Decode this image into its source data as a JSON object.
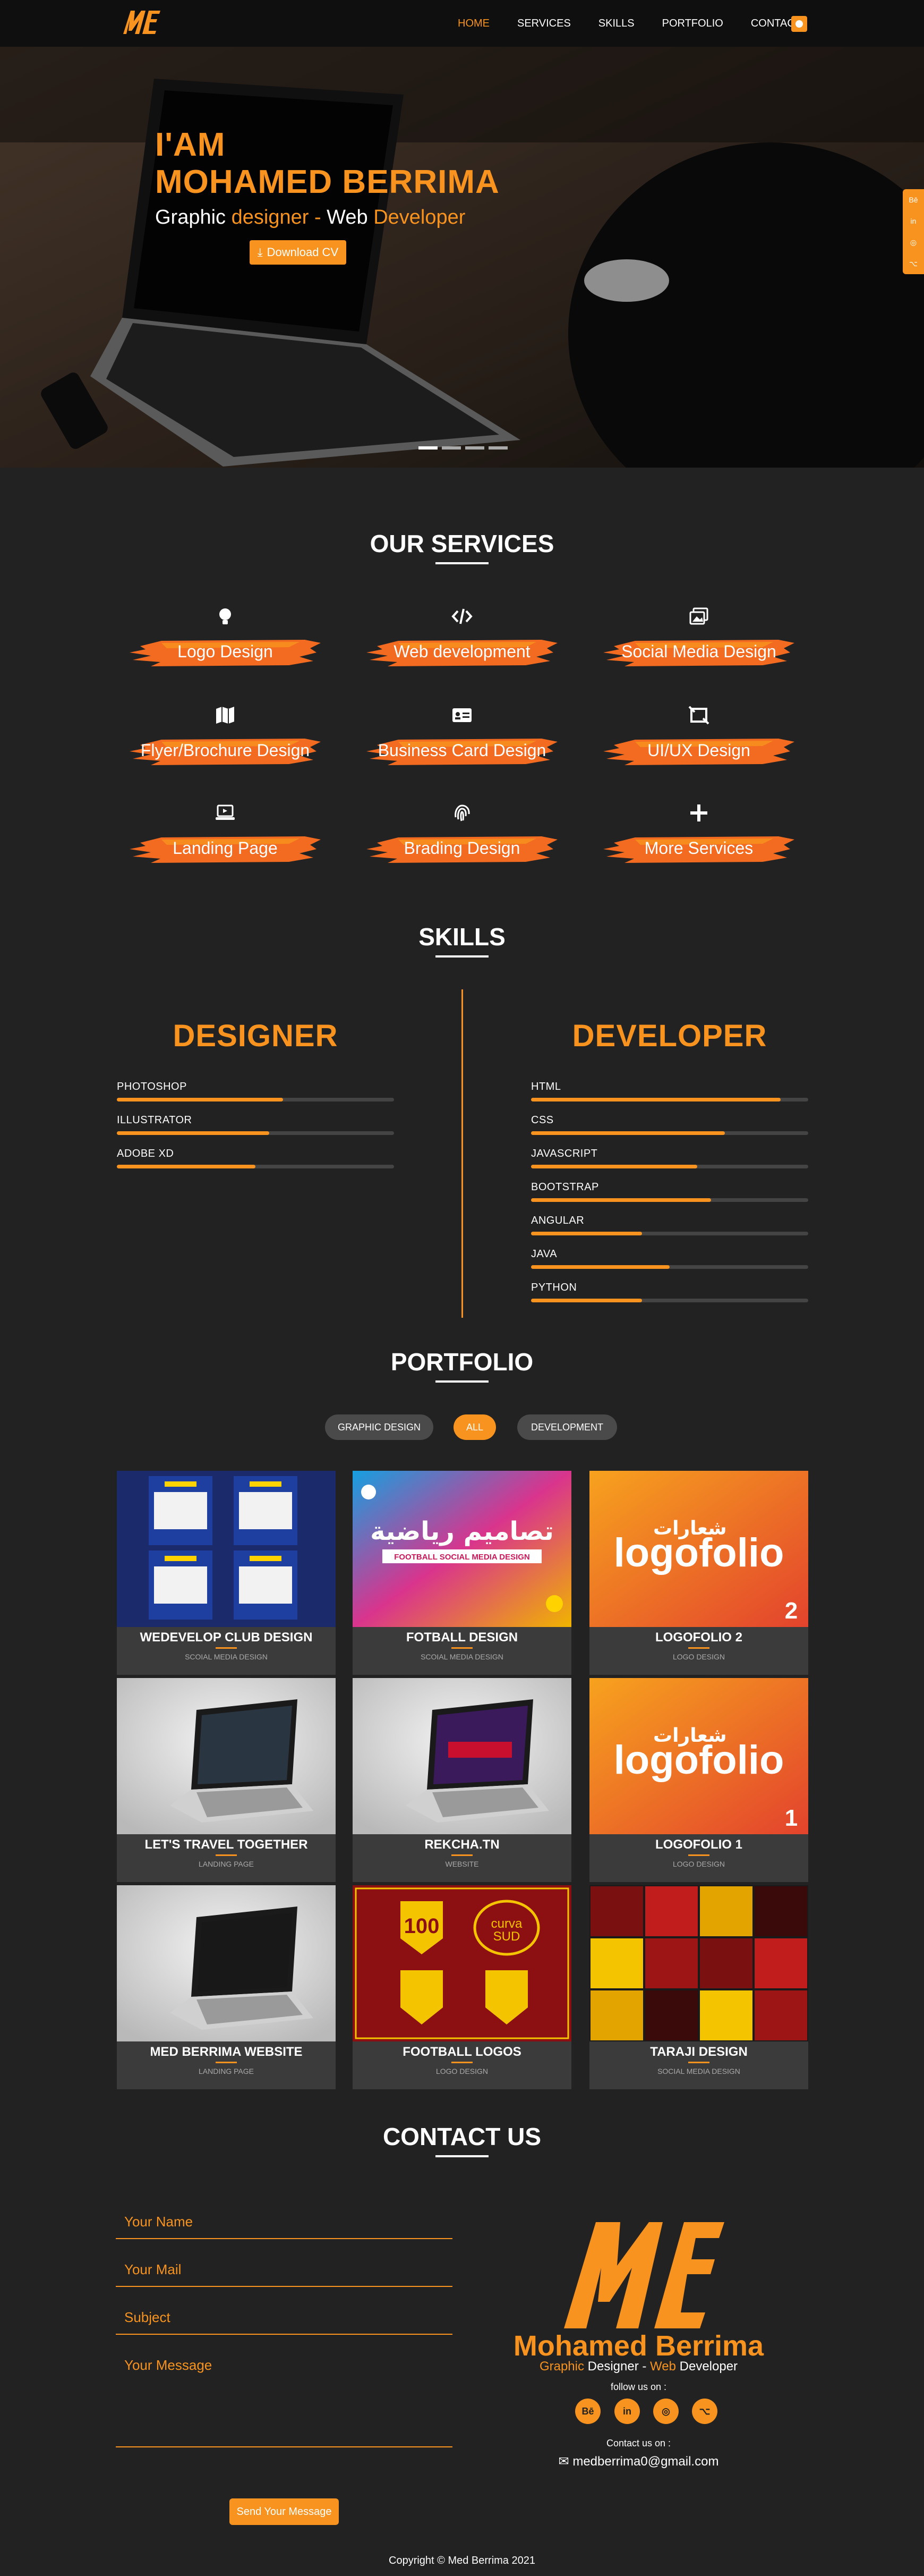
{
  "nav": {
    "logo_text": "MED",
    "items": [
      "HOME",
      "SERVICES",
      "SKILLS",
      "PORTFOLIO",
      "CONTACT"
    ],
    "active": "HOME"
  },
  "hero": {
    "line1": "I'AM",
    "line2": "MOHAMED BERRIMA",
    "sub_a": "Graphic",
    "sub_b": "designer -",
    "sub_c": "Web",
    "sub_d": "Developer",
    "cv_label": "Download CV",
    "slides": 4,
    "active_slide": 1
  },
  "side_social": [
    "behance-icon",
    "linkedin-icon",
    "instagram-icon",
    "github-icon"
  ],
  "services": {
    "title": "OUR SERVICES",
    "items": [
      {
        "label": "Logo Design",
        "icon": "lightbulb-icon"
      },
      {
        "label": "Web development",
        "icon": "code-icon"
      },
      {
        "label": "Social Media Design",
        "icon": "images-icon"
      },
      {
        "label": "Flyer/Brochure Design",
        "icon": "map-icon"
      },
      {
        "label": "Business Card Design",
        "icon": "id-card-icon"
      },
      {
        "label": "UI/UX Design",
        "icon": "crop-icon"
      },
      {
        "label": "Landing Page",
        "icon": "laptop-icon"
      },
      {
        "label": "Brading Design",
        "icon": "fingerprint-icon"
      },
      {
        "label": "More Services",
        "icon": "plus-icon"
      }
    ]
  },
  "skills": {
    "title": "SKILLS",
    "designer": {
      "heading": "DESIGNER",
      "items": [
        {
          "name": "PHOTOSHOP",
          "level": 0.6
        },
        {
          "name": "ILLUSTRATOR",
          "level": 0.55
        },
        {
          "name": "ADOBE XD",
          "level": 0.5
        }
      ]
    },
    "developer": {
      "heading": "DEVELOPER",
      "items": [
        {
          "name": "HTML",
          "level": 0.9
        },
        {
          "name": "CSS",
          "level": 0.7
        },
        {
          "name": "JAVASCRIPT",
          "level": 0.6
        },
        {
          "name": "BOOTSTRAP",
          "level": 0.65
        },
        {
          "name": "ANGULAR",
          "level": 0.4
        },
        {
          "name": "JAVA",
          "level": 0.5
        },
        {
          "name": "PYTHON",
          "level": 0.4
        }
      ]
    }
  },
  "portfolio": {
    "title": "PORTFOLIO",
    "filters": [
      "GRAPHIC DESIGN",
      "ALL",
      "DEVELOPMENT"
    ],
    "active_filter": "ALL",
    "items": [
      {
        "title": "WEDEVELOP CLUB DESIGN",
        "category": "SCOIAL MEDIA DESIGN",
        "art": "wedevelop"
      },
      {
        "title": "FOTBALL DESIGN",
        "category": "SCOIAL MEDIA DESIGN",
        "art": "football",
        "arabic": "تصاميم رياضية",
        "banner": "FOOTBALL SOCIAL MEDIA DESIGN"
      },
      {
        "title": "LOGOFOLIO 2",
        "category": "LOGO DESIGN",
        "art": "logofolio",
        "word": "logofolio",
        "arabic": "شعارات",
        "num": "2"
      },
      {
        "title": "LET'S TRAVEL TOGETHER",
        "category": "LANDING PAGE",
        "art": "laptop1"
      },
      {
        "title": "REKCHA.TN",
        "category": "WEBSITE",
        "art": "laptop2"
      },
      {
        "title": "LOGOFOLIO 1",
        "category": "LOGO DESIGN",
        "art": "logofolio",
        "word": "logofolio",
        "arabic": "شعارات",
        "num": "1"
      },
      {
        "title": "MED BERRIMA WEBSITE",
        "category": "LANDING PAGE",
        "art": "laptop3"
      },
      {
        "title": "FOOTBALL LOGOS",
        "category": "LOGO DESIGN",
        "art": "logos"
      },
      {
        "title": "TARAJI DESIGN",
        "category": "SOCIAL MEDIA DESIGN",
        "art": "taraji"
      }
    ]
  },
  "contact": {
    "title": "CONTACT US",
    "name_ph": "Your Name",
    "mail_ph": "Your Mail",
    "subject_ph": "Subject",
    "message_ph": "Your Message",
    "send_label": "Send Your Message",
    "logo_text": "MED",
    "name": "Mohamed Berrima",
    "tag_a": "Graphic",
    "tag_b": "Designer -",
    "tag_c": "Web",
    "tag_d": "Developer",
    "follow": "follow us on :",
    "social": [
      "Bē",
      "in",
      "◎",
      "⌥"
    ],
    "contact_on": "Contact us on :",
    "email": "medberrima0@gmail.com"
  },
  "footer": {
    "copyright": "Copyright © Med Berrima 2021"
  },
  "colors": {
    "accent": "#f7931e",
    "bg": "#222222",
    "nav": "#0f0f0f"
  }
}
